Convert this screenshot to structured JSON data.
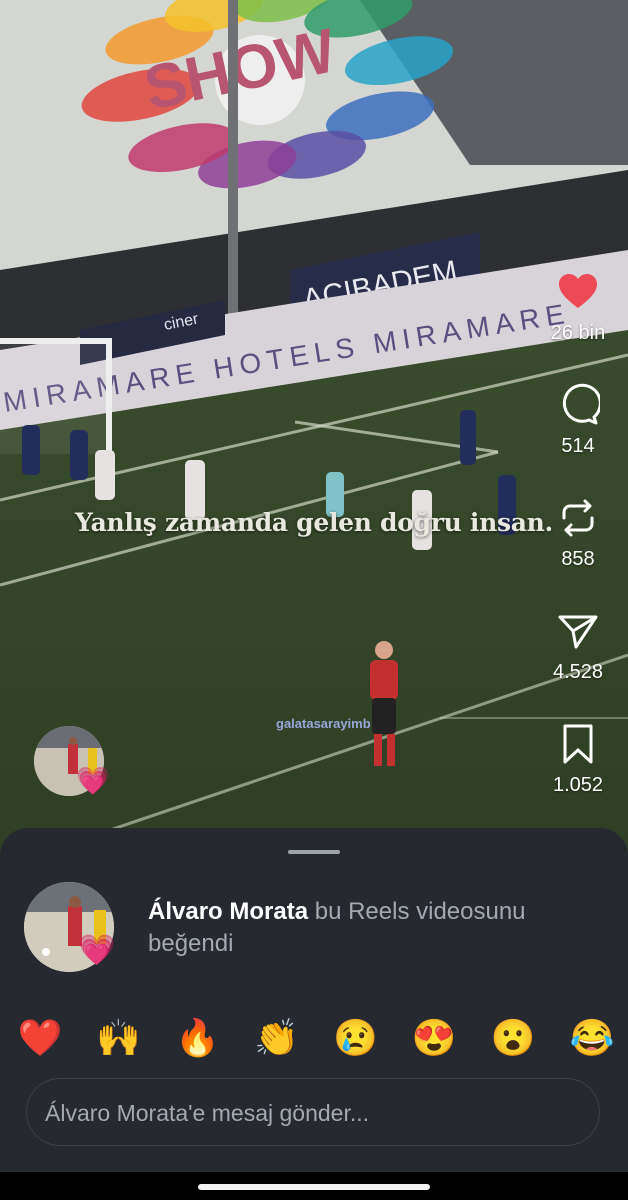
{
  "video": {
    "caption": "Yanlış zamanda gelen doğru insan.",
    "watermark": "galatasarayimb",
    "stadium_signs": {
      "banner": "SHOW",
      "board_1": "ACIBADEM",
      "board_2": "MIRAMARE HOTELS MIRAMARE",
      "board_3": "ciner"
    }
  },
  "actions": [
    {
      "name": "like",
      "icon": "heart-icon",
      "count": "26 bin",
      "active_color": "#ed4956"
    },
    {
      "name": "comment",
      "icon": "comment-icon",
      "count": "514"
    },
    {
      "name": "repost",
      "icon": "repost-icon",
      "count": "858"
    },
    {
      "name": "share",
      "icon": "send-icon",
      "count": "4.528"
    },
    {
      "name": "save",
      "icon": "bookmark-icon",
      "count": "1.052"
    }
  ],
  "sheet": {
    "liker_name": "Álvaro Morata",
    "liker_action": " bu Reels videosunu beğendi",
    "reactions": [
      "❤️",
      "🙌",
      "🔥",
      "👏",
      "😢",
      "😍",
      "😮",
      "😂"
    ],
    "message_placeholder": "Álvaro Morata'e mesaj gönder..."
  },
  "colors": {
    "sheet_bg": "#262a30",
    "accent_like": "#ed4956",
    "muted_text": "#a4a9b0"
  }
}
